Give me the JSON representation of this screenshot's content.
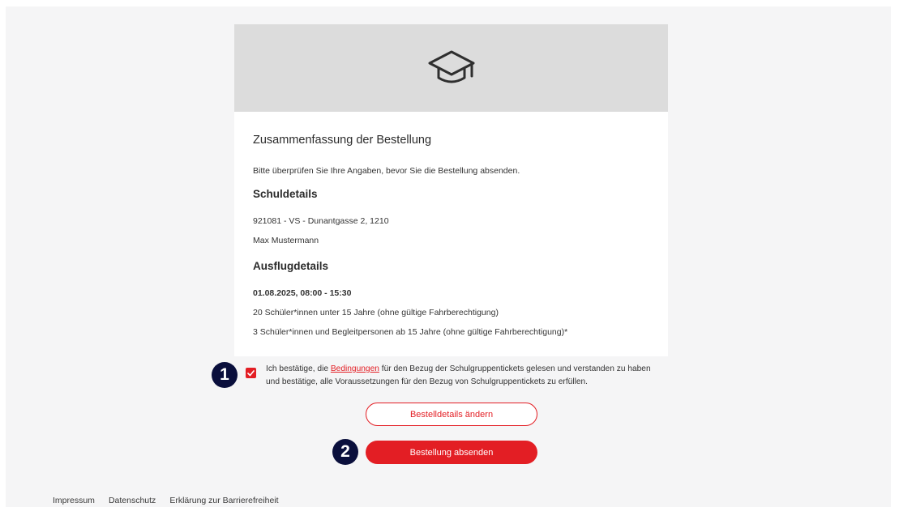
{
  "hero": {
    "icon": "graduation-cap-icon"
  },
  "summary": {
    "title": "Zusammenfassung der Bestellung",
    "intro": "Bitte überprüfen Sie Ihre Angaben, bevor Sie die Bestellung absenden."
  },
  "school": {
    "heading": "Schuldetails",
    "line1": "921081 - VS - Dunantgasse 2, 1210",
    "line2": "Max Mustermann"
  },
  "trip": {
    "heading": "Ausflugdetails",
    "date": "01.08.2025, 08:00 - 15:30",
    "line1": "20 Schüler*innen unter 15 Jahre (ohne gültige Fahrberechtigung)",
    "line2": "3 Schüler*innen und Begleitpersonen ab 15 Jahre (ohne gültige Fahrberechtigung)*"
  },
  "consent": {
    "checked": true,
    "before": "Ich bestätige, die ",
    "link": "Bedingungen",
    "after": " für den Bezug der Schulgruppentickets gelesen und verstanden zu haben und bestätige, alle Voraussetzungen für den Bezug von Schulgruppentickets zu erfüllen."
  },
  "badges": {
    "one": "1",
    "two": "2"
  },
  "buttons": {
    "change": "Bestelldetails ändern",
    "submit": "Bestellung absenden"
  },
  "footer": {
    "links": [
      "Impressum",
      "Datenschutz",
      "Erklärung zur Barrierefreiheit"
    ]
  },
  "colors": {
    "accent": "#e31e24",
    "badge": "#0a0f3c",
    "hero_bg": "#dcdcdc",
    "page_bg": "#f5f5f6"
  }
}
